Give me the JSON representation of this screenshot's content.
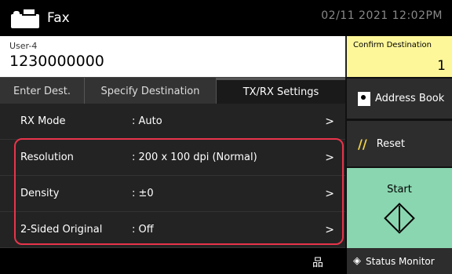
{
  "header": {
    "app_title": "Fax",
    "app_icon": "fax-icon",
    "datetime": "02/11 2021 12:02PM"
  },
  "destination": {
    "user": "User-4",
    "number": "1230000000",
    "confirm_label": "Confirm Destination",
    "confirm_count": "1"
  },
  "tabs": [
    {
      "label": "Enter Dest.",
      "selected": false
    },
    {
      "label": "Specify Destination",
      "selected": false
    },
    {
      "label": "TX/RX Settings",
      "selected": true
    }
  ],
  "settings": [
    {
      "label": "RX Mode",
      "value": ": Auto"
    },
    {
      "label": "Resolution",
      "value": ": 200 x 100 dpi (Normal)"
    },
    {
      "label": "Density",
      "value": ": ±0"
    },
    {
      "label": "2-Sided Original",
      "value": ": Off"
    }
  ],
  "side": {
    "address_book": "Address Book",
    "reset": "Reset",
    "start": "Start"
  },
  "footer": {
    "status_monitor": "Status Monitor",
    "network_icon": "network-icon"
  },
  "colors": {
    "confirm_bg": "#fdf79a",
    "start_bg": "#8ad6b0",
    "highlight": "#e8344a",
    "reset_icon": "#f4d44a"
  }
}
